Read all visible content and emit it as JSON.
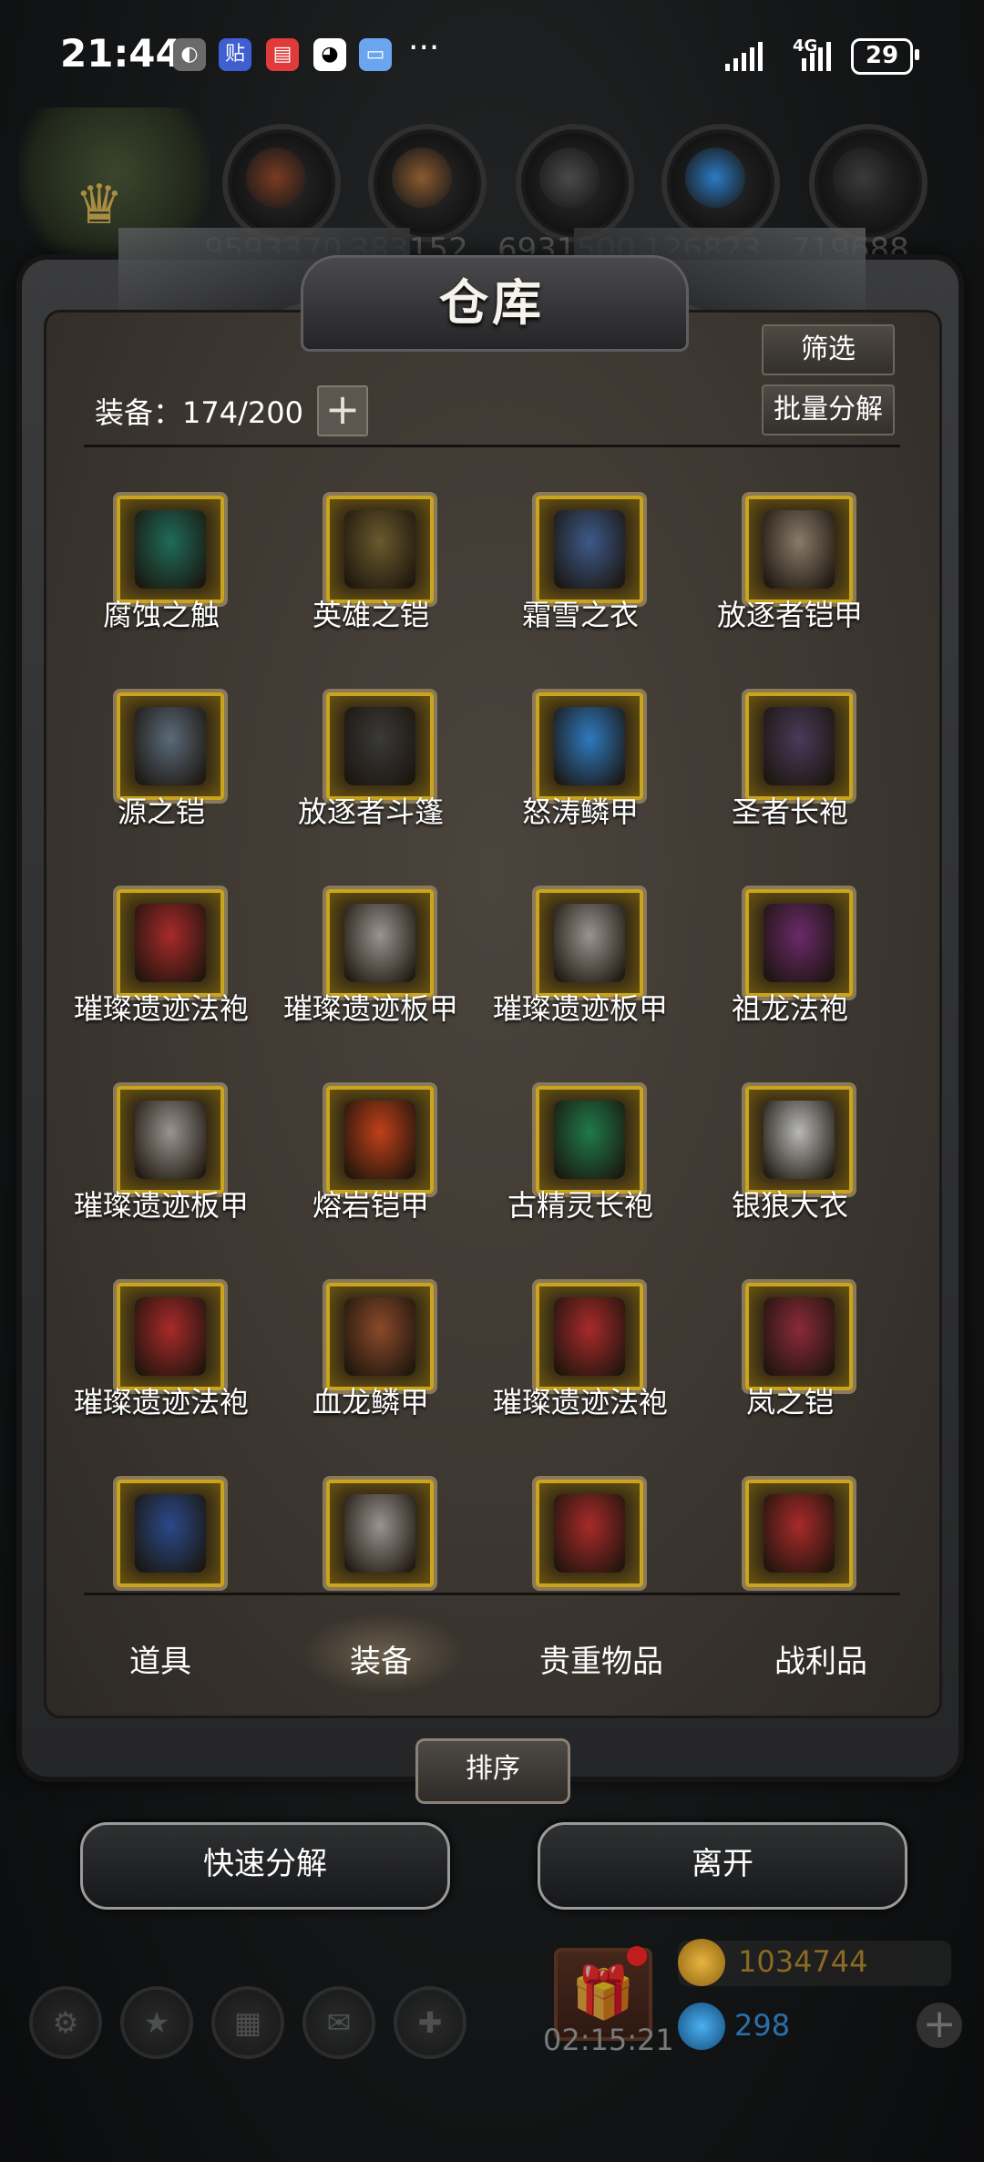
{
  "status_bar": {
    "time": "21:44",
    "network": "4G",
    "battery": "29",
    "more": "···"
  },
  "resources": [
    {
      "value": "9593370",
      "icon": "meat-icon",
      "color": "#7a3b22"
    },
    {
      "value": "383152",
      "icon": "wood-icon",
      "color": "#8a5a2e"
    },
    {
      "value": "6931500",
      "icon": "stone-icon",
      "color": "#4a4a4a"
    },
    {
      "value": "126823",
      "icon": "crystal-icon",
      "color": "#2c7bc4"
    },
    {
      "value": "719688",
      "icon": "iron-icon",
      "color": "#3a3a3a"
    }
  ],
  "panel": {
    "title": "仓库",
    "count_label": "装备：174/200",
    "filter_label": "筛选",
    "batch_label": "批量分解"
  },
  "items": [
    {
      "name": "腐蚀之触",
      "icon": "staff-icon",
      "color": "#1f6b5a"
    },
    {
      "name": "英雄之铠",
      "icon": "armor-icon",
      "color": "#6b5a2e"
    },
    {
      "name": "霜雪之衣",
      "icon": "cloak-icon",
      "color": "#3d5a8a"
    },
    {
      "name": "放逐者铠甲",
      "icon": "armor-icon",
      "color": "#8a7a6a"
    },
    {
      "name": "源之铠",
      "icon": "armor-icon",
      "color": "#5a6a7a"
    },
    {
      "name": "放逐者斗篷",
      "icon": "cloak-icon",
      "color": "#3a3a3a"
    },
    {
      "name": "怒涛鳞甲",
      "icon": "armor-icon",
      "color": "#2e7ac0"
    },
    {
      "name": "圣者长袍",
      "icon": "robe-icon",
      "color": "#4a3a5a"
    },
    {
      "name": "璀璨遗迹法袍",
      "icon": "robe-icon",
      "color": "#a82a2a"
    },
    {
      "name": "璀璨遗迹板甲",
      "icon": "armor-icon",
      "color": "#9a9490"
    },
    {
      "name": "璀璨遗迹板甲",
      "icon": "armor-icon",
      "color": "#9a9490"
    },
    {
      "name": "祖龙法袍",
      "icon": "robe-icon",
      "color": "#6a2a6a"
    },
    {
      "name": "璀璨遗迹板甲",
      "icon": "armor-icon",
      "color": "#9a9490"
    },
    {
      "name": "熔岩铠甲",
      "icon": "armor-icon",
      "color": "#c0401a"
    },
    {
      "name": "古精灵长袍",
      "icon": "cloak-icon",
      "color": "#1f7a4a"
    },
    {
      "name": "银狼大衣",
      "icon": "coat-icon",
      "color": "#b8b8b8"
    },
    {
      "name": "璀璨遗迹法袍",
      "icon": "robe-icon",
      "color": "#a82a2a"
    },
    {
      "name": "血龙鳞甲",
      "icon": "armor-icon",
      "color": "#8a4a2a"
    },
    {
      "name": "璀璨遗迹法袍",
      "icon": "robe-icon",
      "color": "#a82a2a"
    },
    {
      "name": "岚之铠",
      "icon": "armor-icon",
      "color": "#8a2a3a"
    },
    {
      "name": "",
      "icon": "robe-icon",
      "color": "#2a4a8a"
    },
    {
      "name": "",
      "icon": "armor-icon",
      "color": "#9a9490"
    },
    {
      "name": "",
      "icon": "robe-icon",
      "color": "#a82a2a"
    },
    {
      "name": "",
      "icon": "robe-icon",
      "color": "#a82a2a"
    }
  ],
  "tabs": [
    "道具",
    "装备",
    "贵重物品",
    "战利品"
  ],
  "sort_label": "排序",
  "actions": {
    "quick_decompose": "快速分解",
    "leave": "离开"
  },
  "hud": {
    "timer": "02:15:21",
    "gold": "1034744",
    "gems": "298"
  }
}
